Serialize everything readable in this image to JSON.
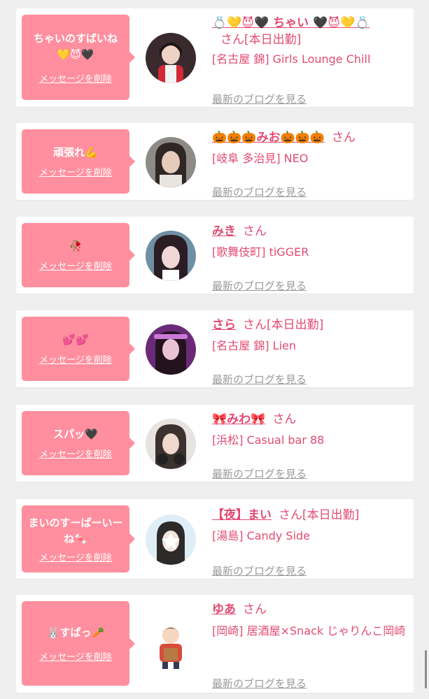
{
  "accent": "#e34a72",
  "bubble_color": "#ff8f9e",
  "delete_label": "メッセージを削除",
  "blog_label": "最新のブログを見る",
  "san": "さん",
  "today_label": "[本日出勤]",
  "entries": [
    {
      "message": "ちゃいのすばいね💛😈🖤",
      "name": "💍💛😈🖤 ちゃい 🖤😈💛💍",
      "shop": "[名古屋 錦] Girls Lounge Chill",
      "today": true
    },
    {
      "message": "頑張れ💪",
      "name": "🎃🎃🎃みお🎃🎃🎃",
      "shop": "[岐阜 多治見] NEO",
      "today": false
    },
    {
      "message": "🥀",
      "name": "みき",
      "shop": "[歌舞伎町] tiGGER",
      "today": false
    },
    {
      "message": "💕💕",
      "name": "さら",
      "shop": "[名古屋 錦] Lien",
      "today": true
    },
    {
      "message": "スパッ🖤",
      "name": "🎀みわ🎀",
      "shop": "[浜松] Casual bar 88",
      "today": false
    },
    {
      "message": "まいのすーぱーいーね🍬",
      "name": "【夜】まい",
      "shop": "[湯島] Candy Side",
      "today": true
    },
    {
      "message": "🐰すぱっ🥕",
      "name": "ゆあ",
      "shop": "[岡崎] 居酒屋×Snack じゃりんこ岡崎",
      "today": false
    }
  ]
}
